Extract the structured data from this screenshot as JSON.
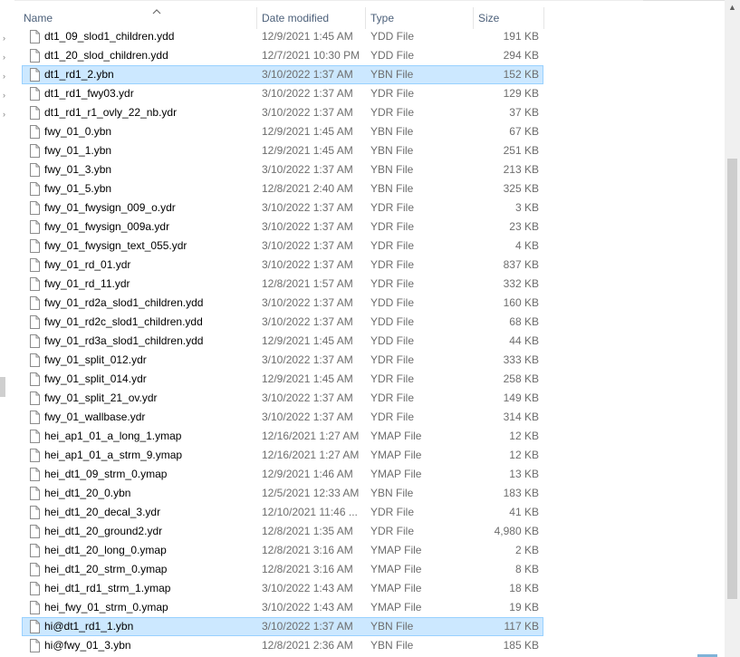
{
  "columns": {
    "name": "Name",
    "date": "Date modified",
    "type": "Type",
    "size": "Size"
  },
  "sort": {
    "column": "name",
    "direction": "ascending"
  },
  "colors": {
    "selection_bg": "#cce8ff",
    "selection_border": "#99d1ff",
    "header_text": "#4c607a",
    "meta_text": "#6d6d6d"
  },
  "files": [
    {
      "name": "dt1_09_slod1_children.ydd",
      "date": "12/9/2021 1:45 AM",
      "type": "YDD File",
      "size": "191 KB",
      "selected": false
    },
    {
      "name": "dt1_20_slod_children.ydd",
      "date": "12/7/2021 10:30 PM",
      "type": "YDD File",
      "size": "294 KB",
      "selected": false
    },
    {
      "name": "dt1_rd1_2.ybn",
      "date": "3/10/2022 1:37 AM",
      "type": "YBN File",
      "size": "152 KB",
      "selected": true
    },
    {
      "name": "dt1_rd1_fwy03.ydr",
      "date": "3/10/2022 1:37 AM",
      "type": "YDR File",
      "size": "129 KB",
      "selected": false
    },
    {
      "name": "dt1_rd1_r1_ovly_22_nb.ydr",
      "date": "3/10/2022 1:37 AM",
      "type": "YDR File",
      "size": "37 KB",
      "selected": false
    },
    {
      "name": "fwy_01_0.ybn",
      "date": "12/9/2021 1:45 AM",
      "type": "YBN File",
      "size": "67 KB",
      "selected": false
    },
    {
      "name": "fwy_01_1.ybn",
      "date": "12/9/2021 1:45 AM",
      "type": "YBN File",
      "size": "251 KB",
      "selected": false
    },
    {
      "name": "fwy_01_3.ybn",
      "date": "3/10/2022 1:37 AM",
      "type": "YBN File",
      "size": "213 KB",
      "selected": false
    },
    {
      "name": "fwy_01_5.ybn",
      "date": "12/8/2021 2:40 AM",
      "type": "YBN File",
      "size": "325 KB",
      "selected": false
    },
    {
      "name": "fwy_01_fwysign_009_o.ydr",
      "date": "3/10/2022 1:37 AM",
      "type": "YDR File",
      "size": "3 KB",
      "selected": false
    },
    {
      "name": "fwy_01_fwysign_009a.ydr",
      "date": "3/10/2022 1:37 AM",
      "type": "YDR File",
      "size": "23 KB",
      "selected": false
    },
    {
      "name": "fwy_01_fwysign_text_055.ydr",
      "date": "3/10/2022 1:37 AM",
      "type": "YDR File",
      "size": "4 KB",
      "selected": false
    },
    {
      "name": "fwy_01_rd_01.ydr",
      "date": "3/10/2022 1:37 AM",
      "type": "YDR File",
      "size": "837 KB",
      "selected": false
    },
    {
      "name": "fwy_01_rd_11.ydr",
      "date": "12/8/2021 1:57 AM",
      "type": "YDR File",
      "size": "332 KB",
      "selected": false
    },
    {
      "name": "fwy_01_rd2a_slod1_children.ydd",
      "date": "3/10/2022 1:37 AM",
      "type": "YDD File",
      "size": "160 KB",
      "selected": false
    },
    {
      "name": "fwy_01_rd2c_slod1_children.ydd",
      "date": "3/10/2022 1:37 AM",
      "type": "YDD File",
      "size": "68 KB",
      "selected": false
    },
    {
      "name": "fwy_01_rd3a_slod1_children.ydd",
      "date": "12/9/2021 1:45 AM",
      "type": "YDD File",
      "size": "44 KB",
      "selected": false
    },
    {
      "name": "fwy_01_split_012.ydr",
      "date": "3/10/2022 1:37 AM",
      "type": "YDR File",
      "size": "333 KB",
      "selected": false
    },
    {
      "name": "fwy_01_split_014.ydr",
      "date": "12/9/2021 1:45 AM",
      "type": "YDR File",
      "size": "258 KB",
      "selected": false
    },
    {
      "name": "fwy_01_split_21_ov.ydr",
      "date": "3/10/2022 1:37 AM",
      "type": "YDR File",
      "size": "149 KB",
      "selected": false
    },
    {
      "name": "fwy_01_wallbase.ydr",
      "date": "3/10/2022 1:37 AM",
      "type": "YDR File",
      "size": "314 KB",
      "selected": false
    },
    {
      "name": "hei_ap1_01_a_long_1.ymap",
      "date": "12/16/2021 1:27 AM",
      "type": "YMAP File",
      "size": "12 KB",
      "selected": false
    },
    {
      "name": "hei_ap1_01_a_strm_9.ymap",
      "date": "12/16/2021 1:27 AM",
      "type": "YMAP File",
      "size": "12 KB",
      "selected": false
    },
    {
      "name": "hei_dt1_09_strm_0.ymap",
      "date": "12/9/2021 1:46 AM",
      "type": "YMAP File",
      "size": "13 KB",
      "selected": false
    },
    {
      "name": "hei_dt1_20_0.ybn",
      "date": "12/5/2021 12:33 AM",
      "type": "YBN File",
      "size": "183 KB",
      "selected": false
    },
    {
      "name": "hei_dt1_20_decal_3.ydr",
      "date": "12/10/2021 11:46 ...",
      "type": "YDR File",
      "size": "41 KB",
      "selected": false
    },
    {
      "name": "hei_dt1_20_ground2.ydr",
      "date": "12/8/2021 1:35 AM",
      "type": "YDR File",
      "size": "4,980 KB",
      "selected": false
    },
    {
      "name": "hei_dt1_20_long_0.ymap",
      "date": "12/8/2021 3:16 AM",
      "type": "YMAP File",
      "size": "2 KB",
      "selected": false
    },
    {
      "name": "hei_dt1_20_strm_0.ymap",
      "date": "12/8/2021 3:16 AM",
      "type": "YMAP File",
      "size": "8 KB",
      "selected": false
    },
    {
      "name": "hei_dt1_rd1_strm_1.ymap",
      "date": "3/10/2022 1:43 AM",
      "type": "YMAP File",
      "size": "18 KB",
      "selected": false
    },
    {
      "name": "hei_fwy_01_strm_0.ymap",
      "date": "3/10/2022 1:43 AM",
      "type": "YMAP File",
      "size": "19 KB",
      "selected": false
    },
    {
      "name": "hi@dt1_rd1_1.ybn",
      "date": "3/10/2022 1:37 AM",
      "type": "YBN File",
      "size": "117 KB",
      "selected": true
    },
    {
      "name": "hi@fwy_01_3.ybn",
      "date": "12/8/2021 2:36 AM",
      "type": "YBN File",
      "size": "185 KB",
      "selected": false
    }
  ],
  "icons": {
    "file": "file-icon",
    "sort": "sort-ascending-icon",
    "pin": "pin-arrow-icon",
    "scroll_up": "scroll-up-arrow-icon"
  },
  "scroll_glyph": "▲",
  "pin_glyph": "›"
}
